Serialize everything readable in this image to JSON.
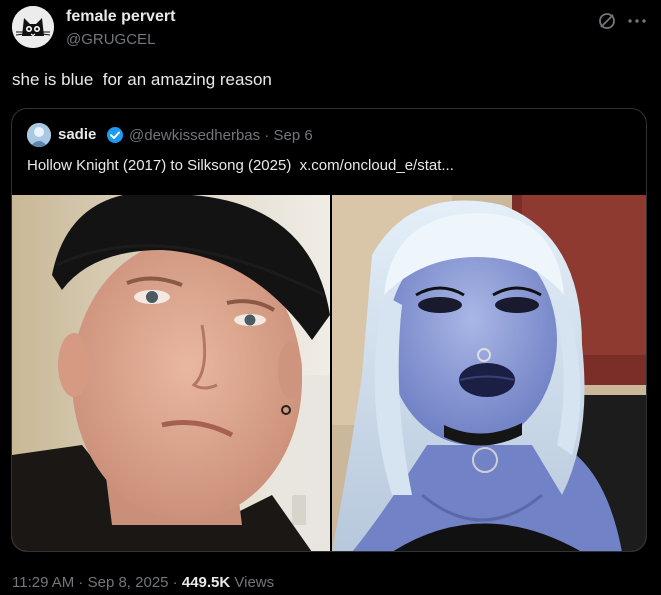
{
  "author": {
    "name": "female pervert",
    "handle": "@GRUGCEL"
  },
  "tweet": {
    "text": "she is blue  for an amazing reason"
  },
  "header_icons": [
    "grok-icon",
    "more-icon"
  ],
  "quote": {
    "name": "sadie",
    "handle": "@dewkissedherbas",
    "separator": " · ",
    "date": "Sep 6",
    "text": "Hollow Knight (2017) to Silksong (2025)  x.com/oncloud_e/stat..."
  },
  "footer": {
    "time": "11:29 AM",
    "sep1": " · ",
    "date": "Sep 8, 2025",
    "sep2": " · ",
    "views_count": "449.5K",
    "views_label": " Views"
  },
  "colors": {
    "background": "#000000",
    "text": "#e7e9ea",
    "muted": "#71767b",
    "border": "#2f3336",
    "verified": "#1d9bf0"
  }
}
